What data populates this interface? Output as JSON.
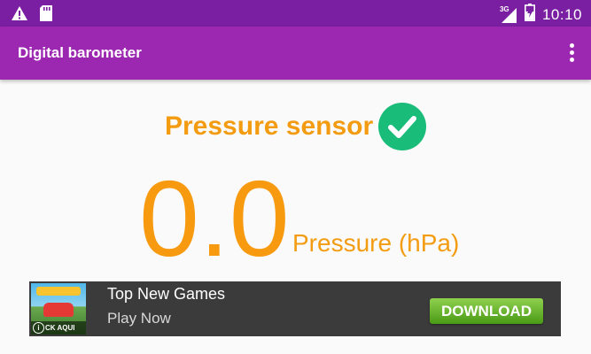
{
  "status_bar": {
    "time": "10:10",
    "network": "3G",
    "icons": [
      "warning-icon",
      "sd-card-icon",
      "signal-icon",
      "battery-charging-icon"
    ]
  },
  "app_bar": {
    "title": "Digital barometer",
    "menu_icon": "more-vert-icon"
  },
  "sensor": {
    "label": "Pressure sensor",
    "status_icon": "check-circle-icon",
    "status_color": "#1abc7a"
  },
  "reading": {
    "value": "0.0",
    "unit": "Pressure (hPa)"
  },
  "ad": {
    "title": "Top New Games",
    "subtitle": "Play Now",
    "button": "DOWNLOAD",
    "thumb_caption": "CK AQUI",
    "info_icon": "i"
  },
  "colors": {
    "status_bar": "#7b1fa2",
    "app_bar": "#9c27b0",
    "accent": "#f39c12"
  }
}
